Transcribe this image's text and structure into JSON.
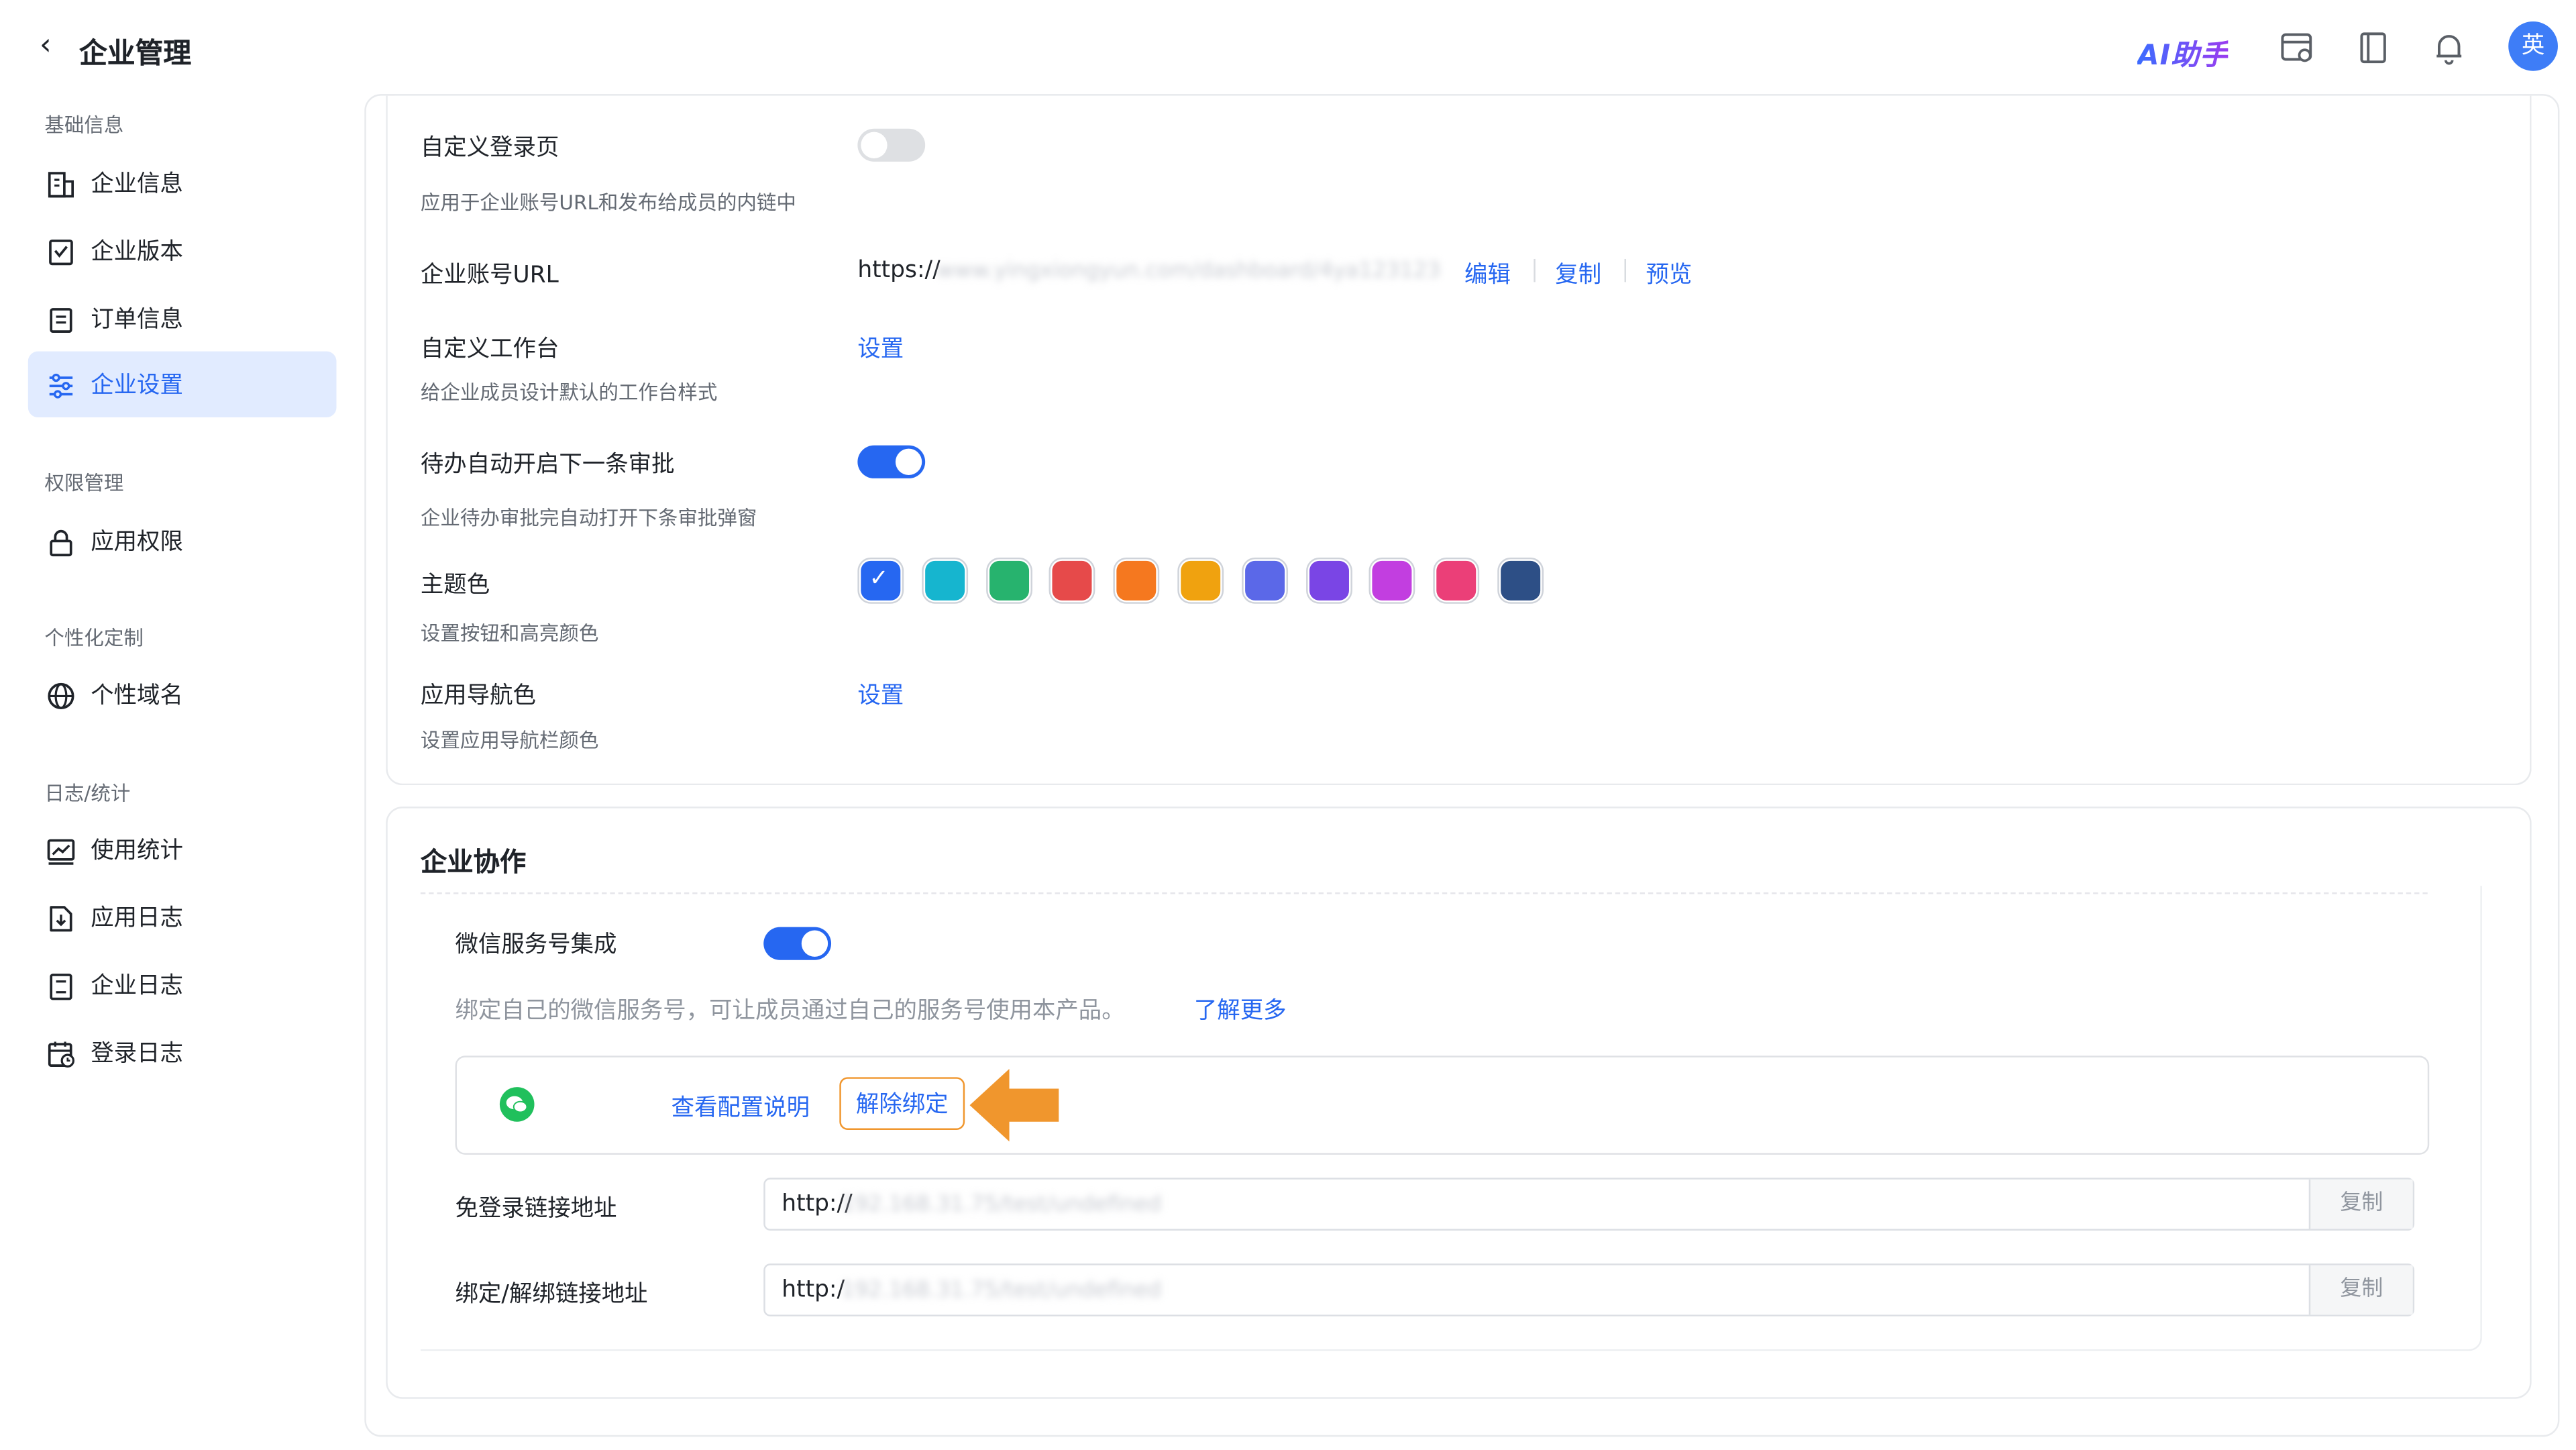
{
  "header": {
    "back_glyph": "‹",
    "title": "企业管理",
    "ai_label": "AI助手",
    "avatar_text": "英",
    "icons": [
      "browser-settings-icon",
      "book-icon",
      "bell-icon"
    ]
  },
  "sidebar": {
    "groups": [
      {
        "label": "基础信息",
        "items": [
          {
            "label": "企业信息",
            "icon": "building-icon"
          },
          {
            "label": "企业版本",
            "icon": "version-icon"
          },
          {
            "label": "订单信息",
            "icon": "order-icon"
          },
          {
            "label": "企业设置",
            "icon": "sliders-icon",
            "active": true
          }
        ]
      },
      {
        "label": "权限管理",
        "items": [
          {
            "label": "应用权限",
            "icon": "lock-icon"
          }
        ]
      },
      {
        "label": "个性化定制",
        "items": [
          {
            "label": "个性域名",
            "icon": "globe-icon"
          }
        ]
      },
      {
        "label": "日志/统计",
        "items": [
          {
            "label": "使用统计",
            "icon": "chart-icon"
          },
          {
            "label": "应用日志",
            "icon": "download-doc-icon"
          },
          {
            "label": "企业日志",
            "icon": "doc-icon"
          },
          {
            "label": "登录日志",
            "icon": "calendar-clock-icon"
          }
        ]
      }
    ]
  },
  "settings": {
    "custom_login": {
      "label": "自定义登录页",
      "desc": "应用于企业账号URL和发布给成员的内链中",
      "enabled": false
    },
    "account_url": {
      "label": "企业账号URL",
      "prefix": "https://",
      "masked": "www.yingxiongyun.com/dashboard/4ya123123",
      "edit": "编辑",
      "copy": "复制",
      "preview": "预览"
    },
    "workbench": {
      "label": "自定义工作台",
      "desc": "给企业成员设计默认的工作台样式",
      "action": "设置"
    },
    "auto_next": {
      "label": "待办自动开启下一条审批",
      "desc": "企业待办审批完自动打开下条审批弹窗",
      "enabled": true
    },
    "theme": {
      "label": "主题色",
      "desc": "设置按钮和高亮颜色",
      "check": "✓",
      "colors": [
        "#2667f1",
        "#16b5cf",
        "#27b36e",
        "#e64a4a",
        "#f5781f",
        "#f0a20f",
        "#5b68e8",
        "#7a45e5",
        "#c23ee0",
        "#eb3f78",
        "#2d4f86"
      ],
      "selected": 0
    },
    "nav_color": {
      "label": "应用导航色",
      "desc": "设置应用导航栏颜色",
      "action": "设置"
    }
  },
  "collab": {
    "title": "企业协作",
    "wechat": {
      "label": "微信服务号集成",
      "enabled": true,
      "desc": "绑定自己的微信服务号，可让成员通过自己的服务号使用本产品。",
      "learn_more": "了解更多",
      "view_config": "查看配置说明",
      "unbind": "解除绑定"
    },
    "fields": [
      {
        "label": "免登录链接地址",
        "prefix": "http://",
        "masked": "192.168.31.75/test/undefined",
        "copy": "复制"
      },
      {
        "label": "绑定/解绑链接地址",
        "prefix": "http:/",
        "masked": "192.168.31.75/test/undefined",
        "copy": "复制"
      }
    ]
  },
  "colors": {
    "accent": "#2667f1",
    "highlight": "#f0962d",
    "wechat": "#20c05c"
  }
}
